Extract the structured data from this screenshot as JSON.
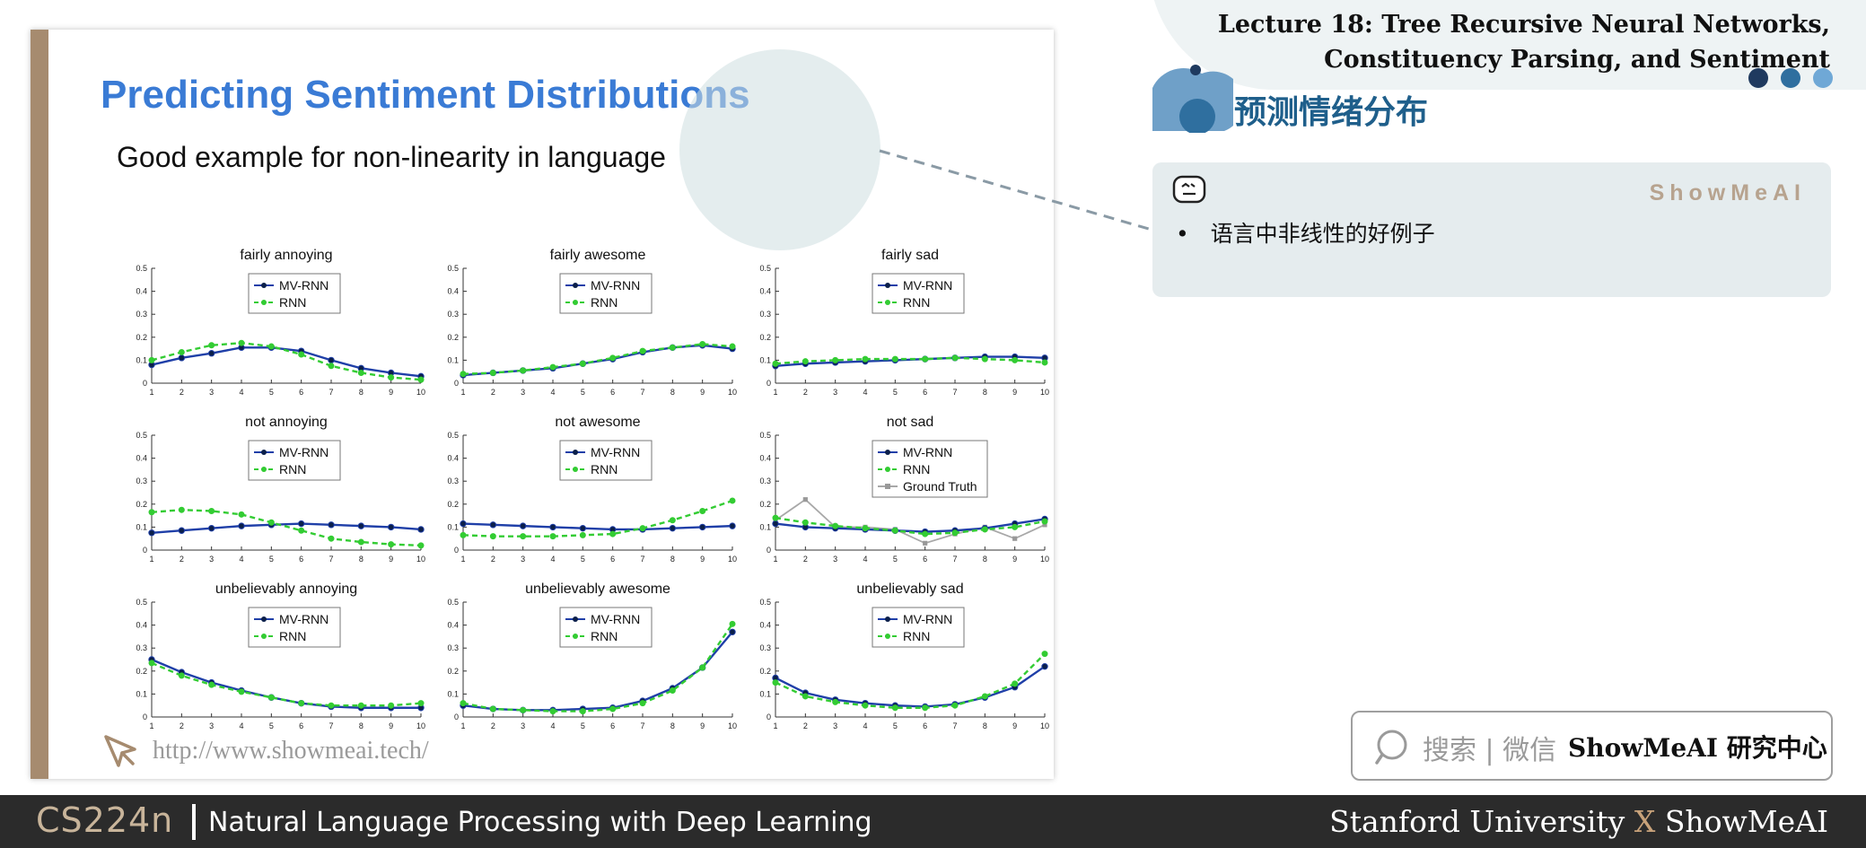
{
  "header": {
    "lecture_title_line1": "Lecture 18: Tree Recursive Neural Networks,",
    "lecture_title_line2": "Constituency Parsing, and Sentiment",
    "section_title": "预测情绪分布",
    "dot_colors": [
      "#1f3a5f",
      "#2f6f9f",
      "#6fa8d6"
    ]
  },
  "slide": {
    "title": "Predicting Sentiment Distributions",
    "subtitle": "Good example for non-linearity in language",
    "link": "http://www.showmeai.tech/",
    "accent_bar_color": "#a68b6f",
    "title_color": "#3a7bd5"
  },
  "note_card": {
    "brand": "ShowMeAI",
    "bullet": "语言中非线性的好例子",
    "icon": "robot-face-icon"
  },
  "search": {
    "icon": "search-icon",
    "label": "搜索 | 微信",
    "brand": "ShowMeAI 研究中心"
  },
  "footer": {
    "course": "CS224n",
    "subtitle": "Natural Language Processing with Deep Learning",
    "right_left": "Stanford University",
    "right_x": "X",
    "right_right": "ShowMeAI"
  },
  "chart_data": [
    {
      "type": "line",
      "title": "fairly annoying",
      "x": [
        1,
        2,
        3,
        4,
        5,
        6,
        7,
        8,
        9,
        10
      ],
      "xlim": [
        1,
        10
      ],
      "ylim": [
        0,
        0.5
      ],
      "yticks": [
        0,
        0.1,
        0.2,
        0.3,
        0.4,
        0.5
      ],
      "legend": "top-center",
      "series": [
        {
          "name": "MV-RNN",
          "values": [
            0.08,
            0.11,
            0.13,
            0.155,
            0.155,
            0.14,
            0.1,
            0.065,
            0.045,
            0.03
          ]
        },
        {
          "name": "RNN",
          "values": [
            0.1,
            0.135,
            0.165,
            0.175,
            0.16,
            0.125,
            0.075,
            0.045,
            0.025,
            0.015
          ]
        }
      ]
    },
    {
      "type": "line",
      "title": "fairly awesome",
      "x": [
        1,
        2,
        3,
        4,
        5,
        6,
        7,
        8,
        9,
        10
      ],
      "xlim": [
        1,
        10
      ],
      "ylim": [
        0,
        0.5
      ],
      "yticks": [
        0,
        0.1,
        0.2,
        0.3,
        0.4,
        0.5
      ],
      "legend": "top-center",
      "series": [
        {
          "name": "MV-RNN",
          "values": [
            0.035,
            0.045,
            0.055,
            0.065,
            0.085,
            0.105,
            0.135,
            0.155,
            0.165,
            0.15
          ]
        },
        {
          "name": "RNN",
          "values": [
            0.04,
            0.045,
            0.055,
            0.07,
            0.085,
            0.11,
            0.14,
            0.155,
            0.17,
            0.16
          ]
        }
      ]
    },
    {
      "type": "line",
      "title": "fairly sad",
      "x": [
        1,
        2,
        3,
        4,
        5,
        6,
        7,
        8,
        9,
        10
      ],
      "xlim": [
        1,
        10
      ],
      "ylim": [
        0,
        0.5
      ],
      "yticks": [
        0,
        0.1,
        0.2,
        0.3,
        0.4,
        0.5
      ],
      "legend": "top-center",
      "series": [
        {
          "name": "MV-RNN",
          "values": [
            0.075,
            0.085,
            0.09,
            0.095,
            0.1,
            0.105,
            0.11,
            0.115,
            0.115,
            0.11
          ]
        },
        {
          "name": "RNN",
          "values": [
            0.085,
            0.095,
            0.1,
            0.105,
            0.105,
            0.105,
            0.11,
            0.105,
            0.1,
            0.09
          ]
        }
      ]
    },
    {
      "type": "line",
      "title": "not annoying",
      "x": [
        1,
        2,
        3,
        4,
        5,
        6,
        7,
        8,
        9,
        10
      ],
      "xlim": [
        1,
        10
      ],
      "ylim": [
        0,
        0.5
      ],
      "yticks": [
        0,
        0.1,
        0.2,
        0.3,
        0.4,
        0.5
      ],
      "legend": "top-center",
      "series": [
        {
          "name": "MV-RNN",
          "values": [
            0.075,
            0.085,
            0.095,
            0.105,
            0.11,
            0.115,
            0.11,
            0.105,
            0.1,
            0.09
          ]
        },
        {
          "name": "RNN",
          "values": [
            0.165,
            0.175,
            0.17,
            0.155,
            0.12,
            0.085,
            0.05,
            0.035,
            0.025,
            0.02
          ]
        }
      ]
    },
    {
      "type": "line",
      "title": "not awesome",
      "x": [
        1,
        2,
        3,
        4,
        5,
        6,
        7,
        8,
        9,
        10
      ],
      "xlim": [
        1,
        10
      ],
      "ylim": [
        0,
        0.5
      ],
      "yticks": [
        0,
        0.1,
        0.2,
        0.3,
        0.4,
        0.5
      ],
      "legend": "top-center",
      "series": [
        {
          "name": "MV-RNN",
          "values": [
            0.115,
            0.11,
            0.105,
            0.1,
            0.095,
            0.09,
            0.09,
            0.095,
            0.1,
            0.105
          ]
        },
        {
          "name": "RNN",
          "values": [
            0.065,
            0.06,
            0.06,
            0.06,
            0.065,
            0.07,
            0.095,
            0.13,
            0.17,
            0.215
          ]
        }
      ]
    },
    {
      "type": "line",
      "title": "not sad",
      "x": [
        1,
        2,
        3,
        4,
        5,
        6,
        7,
        8,
        9,
        10
      ],
      "xlim": [
        1,
        10
      ],
      "ylim": [
        0,
        0.5
      ],
      "yticks": [
        0,
        0.1,
        0.2,
        0.3,
        0.4,
        0.5
      ],
      "legend": "top-center",
      "series": [
        {
          "name": "MV-RNN",
          "values": [
            0.115,
            0.1,
            0.095,
            0.09,
            0.085,
            0.08,
            0.085,
            0.095,
            0.115,
            0.135
          ]
        },
        {
          "name": "RNN",
          "values": [
            0.14,
            0.12,
            0.105,
            0.095,
            0.085,
            0.07,
            0.075,
            0.09,
            0.1,
            0.125
          ]
        },
        {
          "name": "Ground Truth",
          "values": [
            0.13,
            0.22,
            0.1,
            0.1,
            0.09,
            0.03,
            0.07,
            0.1,
            0.05,
            0.11
          ]
        }
      ]
    },
    {
      "type": "line",
      "title": "unbelievably annoying",
      "x": [
        1,
        2,
        3,
        4,
        5,
        6,
        7,
        8,
        9,
        10
      ],
      "xlim": [
        1,
        10
      ],
      "ylim": [
        0,
        0.5
      ],
      "yticks": [
        0,
        0.1,
        0.2,
        0.3,
        0.4,
        0.5
      ],
      "legend": "top-center",
      "series": [
        {
          "name": "MV-RNN",
          "values": [
            0.25,
            0.195,
            0.15,
            0.115,
            0.085,
            0.06,
            0.045,
            0.04,
            0.04,
            0.04
          ]
        },
        {
          "name": "RNN",
          "values": [
            0.235,
            0.18,
            0.14,
            0.11,
            0.085,
            0.06,
            0.05,
            0.05,
            0.05,
            0.06
          ]
        }
      ]
    },
    {
      "type": "line",
      "title": "unbelievably awesome",
      "x": [
        1,
        2,
        3,
        4,
        5,
        6,
        7,
        8,
        9,
        10
      ],
      "xlim": [
        1,
        10
      ],
      "ylim": [
        0,
        0.5
      ],
      "yticks": [
        0,
        0.1,
        0.2,
        0.3,
        0.4,
        0.5
      ],
      "legend": "top-center",
      "series": [
        {
          "name": "MV-RNN",
          "values": [
            0.05,
            0.035,
            0.03,
            0.03,
            0.035,
            0.04,
            0.07,
            0.125,
            0.215,
            0.37
          ]
        },
        {
          "name": "RNN",
          "values": [
            0.06,
            0.035,
            0.03,
            0.025,
            0.025,
            0.035,
            0.06,
            0.115,
            0.215,
            0.405
          ]
        }
      ]
    },
    {
      "type": "line",
      "title": "unbelievably sad",
      "x": [
        1,
        2,
        3,
        4,
        5,
        6,
        7,
        8,
        9,
        10
      ],
      "xlim": [
        1,
        10
      ],
      "ylim": [
        0,
        0.5
      ],
      "yticks": [
        0,
        0.1,
        0.2,
        0.3,
        0.4,
        0.5
      ],
      "legend": "top-center",
      "series": [
        {
          "name": "MV-RNN",
          "values": [
            0.17,
            0.105,
            0.075,
            0.06,
            0.05,
            0.045,
            0.055,
            0.085,
            0.13,
            0.22
          ]
        },
        {
          "name": "RNN",
          "values": [
            0.15,
            0.09,
            0.065,
            0.05,
            0.04,
            0.04,
            0.05,
            0.09,
            0.145,
            0.275
          ]
        }
      ]
    }
  ]
}
